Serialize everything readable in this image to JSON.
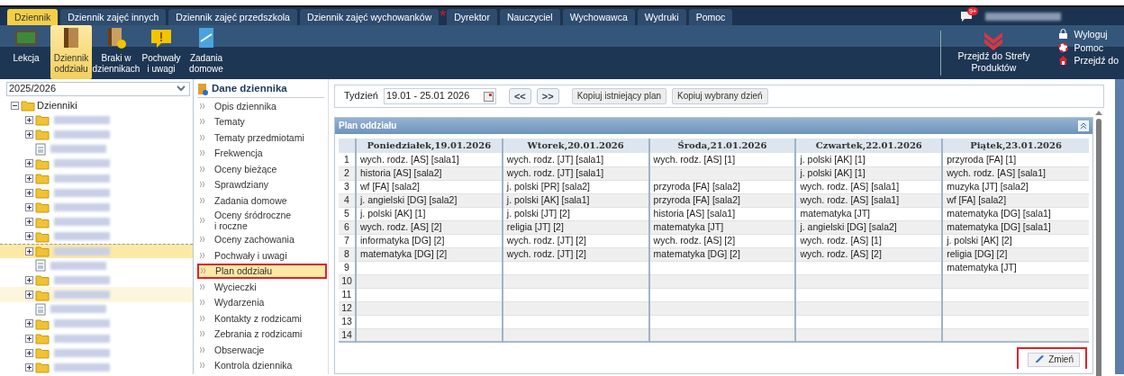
{
  "tabs": [
    {
      "label": "Dziennik",
      "selected": true
    },
    {
      "label": "Dziennik zajęć innych",
      "selected": false
    },
    {
      "label": "Dziennik zajęć przedszkola",
      "selected": false
    },
    {
      "label": "Dziennik zajęć wychowanków",
      "selected": false,
      "marker": "*"
    },
    {
      "label": "Dyrektor",
      "selected": false
    },
    {
      "label": "Nauczyciel",
      "selected": false
    },
    {
      "label": "Wychowawca",
      "selected": false
    },
    {
      "label": "Wydruki",
      "selected": false
    },
    {
      "label": "Pomoc",
      "selected": false
    }
  ],
  "notifications": {
    "badge": "9+"
  },
  "toolbar": {
    "items": [
      {
        "label": "Lekcja",
        "kind": "board",
        "selected": false
      },
      {
        "label": "Dziennik\noddziału",
        "kind": "book",
        "selected": true
      },
      {
        "label": "Braki w\ndziennikach",
        "kind": "missing",
        "selected": false
      },
      {
        "label": "Pochwały\ni uwagi",
        "kind": "note",
        "selected": false
      },
      {
        "label": "Zadania\ndomowe",
        "kind": "homework",
        "selected": false
      }
    ]
  },
  "product_zone": {
    "label": "Przejdź do Strefy\nProduktów"
  },
  "user_links": [
    {
      "label": "Wyloguj",
      "kind": "lock"
    },
    {
      "label": "Pomoc",
      "kind": "help"
    },
    {
      "label": "Przejdź do",
      "kind": "home"
    }
  ],
  "year_select": {
    "value": "2025/2026"
  },
  "tree": {
    "root": {
      "label": "Dzienniki",
      "expanded": true
    },
    "items": [
      {
        "kind": "folder",
        "selected": false,
        "hover": false
      },
      {
        "kind": "folder",
        "selected": false,
        "hover": false
      },
      {
        "kind": "document",
        "selected": false,
        "hover": false
      },
      {
        "kind": "folder",
        "selected": false,
        "hover": false
      },
      {
        "kind": "folder",
        "selected": false,
        "hover": false
      },
      {
        "kind": "folder",
        "selected": false,
        "hover": false
      },
      {
        "kind": "folder",
        "selected": false,
        "hover": false
      },
      {
        "kind": "folder",
        "selected": false,
        "hover": false
      },
      {
        "kind": "folder",
        "selected": false,
        "hover": false
      },
      {
        "kind": "folder",
        "selected": true,
        "hover": false
      },
      {
        "kind": "document",
        "selected": false,
        "hover": false
      },
      {
        "kind": "folder",
        "selected": false,
        "hover": false
      },
      {
        "kind": "folder",
        "selected": false,
        "hover": true
      },
      {
        "kind": "document",
        "selected": false,
        "hover": false
      },
      {
        "kind": "folder",
        "selected": false,
        "hover": false
      },
      {
        "kind": "folder",
        "selected": false,
        "hover": false
      },
      {
        "kind": "folder",
        "selected": false,
        "hover": false
      },
      {
        "kind": "folder",
        "selected": false,
        "hover": false
      }
    ]
  },
  "menu": {
    "title": "Dane dziennika",
    "items": [
      {
        "label": "Opis dziennika",
        "selected": false,
        "highlighted": false
      },
      {
        "label": "Tematy",
        "selected": false,
        "highlighted": false
      },
      {
        "label": "Tematy przedmiotami",
        "selected": false,
        "highlighted": false
      },
      {
        "label": "Frekwencja",
        "selected": false,
        "highlighted": false
      },
      {
        "label": "Oceny bieżące",
        "selected": false,
        "highlighted": false
      },
      {
        "label": "Sprawdziany",
        "selected": false,
        "highlighted": false
      },
      {
        "label": "Zadania domowe",
        "selected": false,
        "highlighted": false
      },
      {
        "label": "Oceny śródroczne\ni roczne",
        "selected": false,
        "highlighted": false
      },
      {
        "label": "Oceny zachowania",
        "selected": false,
        "highlighted": false
      },
      {
        "label": "Pochwały i uwagi",
        "selected": false,
        "highlighted": false
      },
      {
        "label": "Plan oddziału",
        "selected": true,
        "highlighted": true
      },
      {
        "label": "Wycieczki",
        "selected": false,
        "highlighted": false
      },
      {
        "label": "Wydarzenia",
        "selected": false,
        "highlighted": false
      },
      {
        "label": "Kontakty z rodzicami",
        "selected": false,
        "highlighted": false
      },
      {
        "label": "Zebrania z rodzicami",
        "selected": false,
        "highlighted": false
      },
      {
        "label": "Obserwacje",
        "selected": false,
        "highlighted": false
      },
      {
        "label": "Kontrola dziennika",
        "selected": false,
        "highlighted": false
      }
    ]
  },
  "week_bar": {
    "label": "Tydzień",
    "value": "19.01 - 25.01 2026",
    "prev": "<<",
    "next": ">>",
    "buttons": [
      "Kopiuj istniejący plan",
      "Kopiuj wybrany dzień"
    ]
  },
  "plan": {
    "title": "Plan oddziału",
    "columns": [
      "Poniedziałek,19.01.2026",
      "Wtorek,20.01.2026",
      "Środa,21.01.2026",
      "Czwartek,22.01.2026",
      "Piątek,23.01.2026"
    ],
    "rows": [
      {
        "number": "1",
        "cells": [
          "wych. rodz. [AS] [sala1]",
          "wych. rodz. [JT] [sala1]",
          "wych. rodz. [AS] [1]",
          "j. polski [AK] [1]",
          "przyroda [FA] [1]"
        ]
      },
      {
        "number": "2",
        "cells": [
          "historia [AS] [sala2]",
          "wych. rodz. [JT] [sala1]",
          null,
          "j. polski [AK] [1]",
          "wych. rodz. [AS] [sala1]"
        ]
      },
      {
        "number": "3",
        "cells": [
          "wf [FA] [sala2]",
          "j. polski [PR] [sala2]",
          "przyroda [FA] [sala2]",
          "wych. rodz. [AS] [sala1]",
          "muzyka [JT] [sala2]"
        ]
      },
      {
        "number": "4",
        "cells": [
          "j. angielski [DG] [sala2]",
          "j. polski [AK] [sala1]",
          "przyroda [FA] [sala2]",
          "wych. rodz. [AS] [sala1]",
          "wf [FA] [sala2]"
        ]
      },
      {
        "number": "5",
        "cells": [
          "j. polski [AK] [1]",
          "j. polski [JT] [2]",
          "historia [AS] [sala1]",
          "matematyka [JT]",
          "matematyka [DG] [sala1]"
        ]
      },
      {
        "number": "6",
        "cells": [
          "wych. rodz. [AS] [2]",
          "religia [JT] [2]",
          "matematyka [JT]",
          "j. angielski [DG] [sala2]",
          "matematyka [DG] [sala1]"
        ]
      },
      {
        "number": "7",
        "cells": [
          "informatyka [DG] [2]",
          "wych. rodz. [JT] [2]",
          "wych. rodz. [AS] [2]",
          "wych. rodz. [AS] [1]",
          "j. polski [AK] [2]"
        ]
      },
      {
        "number": "8",
        "cells": [
          "matematyka [DG] [2]",
          "wych. rodz. [JT] [2]",
          "matematyka [DG] [2]",
          "wych. rodz. [AS] [2]",
          "religia [DG] [2]"
        ]
      },
      {
        "number": "9",
        "cells": [
          null,
          null,
          null,
          null,
          "matematyka [JT]"
        ]
      },
      {
        "number": "10",
        "cells": [
          null,
          null,
          null,
          null,
          null
        ]
      },
      {
        "number": "11",
        "cells": [
          null,
          null,
          null,
          null,
          null
        ]
      },
      {
        "number": "12",
        "cells": [
          null,
          null,
          null,
          null,
          null
        ]
      },
      {
        "number": "13",
        "cells": [
          null,
          null,
          null,
          null,
          null
        ]
      },
      {
        "number": "14",
        "cells": [
          null,
          null,
          null,
          null,
          null
        ]
      }
    ],
    "change_button": {
      "label": "Zmień",
      "highlighted": true
    }
  }
}
